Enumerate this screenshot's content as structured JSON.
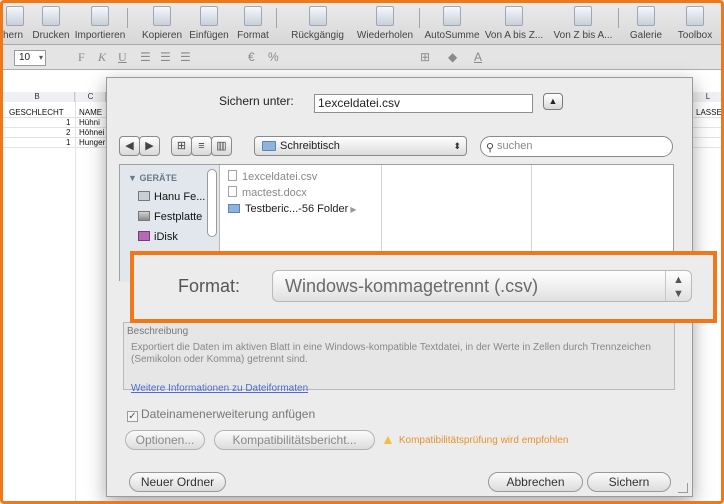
{
  "toolbar": {
    "items": [
      "chern",
      "Drucken",
      "Importieren",
      "Kopieren",
      "Einfügen",
      "Format",
      "Rückgängig",
      "Wiederholen",
      "AutoSumme",
      "Von A bis Z...",
      "Von Z bis A...",
      "Galerie",
      "Toolbox"
    ]
  },
  "format_bar": {
    "font_size": "10",
    "buttons": [
      "F",
      "K",
      "U",
      "€",
      "%"
    ]
  },
  "sheet": {
    "columns": [
      "B",
      "C",
      "L"
    ],
    "header_cells": [
      "GESCHLECHT",
      "NAME",
      "LASSE/("
    ],
    "rows": [
      {
        "num": "1",
        "name": "Hühni"
      },
      {
        "num": "2",
        "name": "Höhnei"
      },
      {
        "num": "1",
        "name": "Hunger"
      }
    ]
  },
  "dialog": {
    "save_as_label": "Sichern unter:",
    "save_as_value": "1exceldatei.csv",
    "location": "Schreibtisch",
    "search_placeholder": "suchen",
    "sidebar": {
      "heading": "GERÄTE",
      "items": [
        "Hanu Fe...",
        "Festplatte",
        "iDisk"
      ],
      "collapsed_heading": "O"
    },
    "files": [
      "1exceldatei.csv",
      "mactest.docx",
      "Testberic...-56 Folder"
    ],
    "format_label": "Format:",
    "format_value": "Windows-kommagetrennt (.csv)",
    "description_title": "Beschreibung",
    "description_text": "Exportiert die Daten im aktiven Blatt in eine Windows-kompatible Textdatei, in der Werte in Zellen durch Trennzeichen (Semikolon oder Komma) getrennt sind.",
    "more_info_link": "Weitere Informationen zu Dateiformaten",
    "extension_checkbox": "Dateinamenerweiterung anfügen",
    "options_button": "Optionen...",
    "compat_button": "Kompatibilitätsbericht...",
    "compat_warning": "Kompatibilitätsprüfung wird empfohlen",
    "new_folder_button": "Neuer Ordner",
    "cancel_button": "Abbrechen",
    "save_button": "Sichern"
  },
  "colors": {
    "highlight": "#f07818",
    "link": "#4d6bd4",
    "warning": "#e8932c"
  }
}
